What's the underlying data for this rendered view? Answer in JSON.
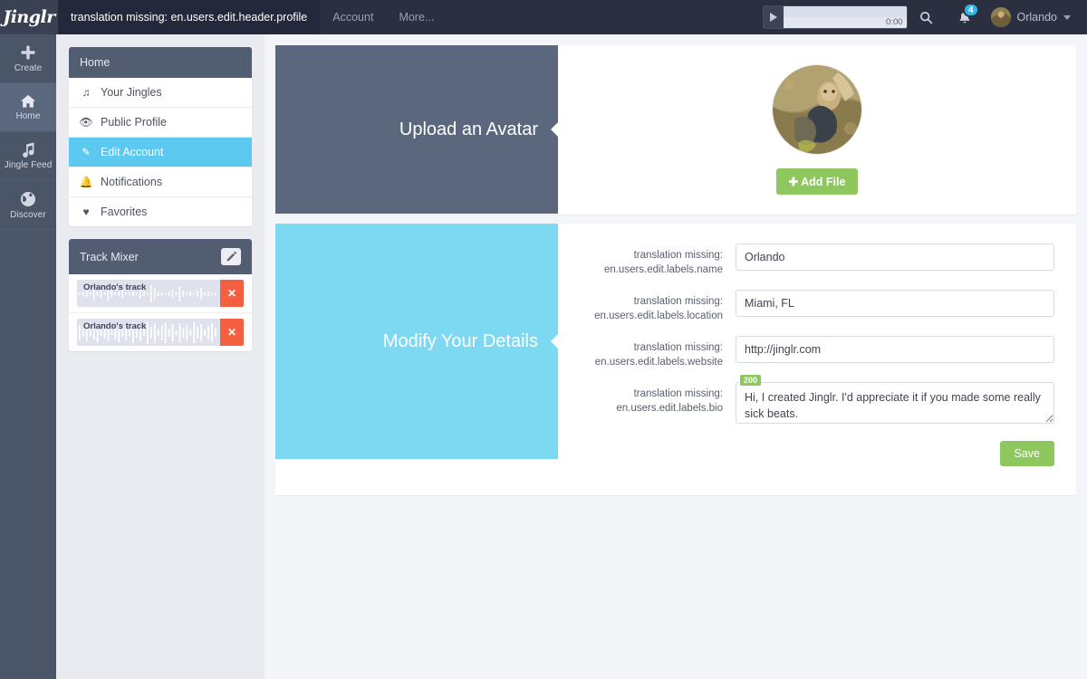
{
  "brand": {
    "name": "Jinglr"
  },
  "topbar": {
    "breadcrumb": "translation missing: en.users.edit.header.profile",
    "nav": [
      {
        "label": "Account",
        "name": "topnav-account"
      },
      {
        "label": "More...",
        "name": "topnav-more"
      }
    ],
    "player": {
      "time": "0:00",
      "play_label": "Play"
    },
    "search_icon": "search-icon",
    "notifications": {
      "icon": "bell-icon",
      "count": "4"
    },
    "user": {
      "name": "Orlando",
      "avatar": "user-avatar"
    }
  },
  "rail": {
    "items": [
      {
        "label": "Create",
        "icon": "plus-icon",
        "active": false
      },
      {
        "label": "Home",
        "icon": "house-icon",
        "active": true
      },
      {
        "label": "Jingle Feed",
        "icon": "music-note-icon",
        "active": false
      },
      {
        "label": "Discover",
        "icon": "globe-icon",
        "active": false
      }
    ]
  },
  "sidebar": {
    "home_header": "Home",
    "nav": [
      {
        "label": "Your Jingles",
        "icon": "♫",
        "active": false
      },
      {
        "label": "Public Profile",
        "icon": "👁",
        "active": false
      },
      {
        "label": "Edit Account",
        "icon": "✎",
        "active": true
      },
      {
        "label": "Notifications",
        "icon": "🔔",
        "active": false
      },
      {
        "label": "Favorites",
        "icon": "♥",
        "active": false
      }
    ],
    "mixer": {
      "title": "Track Mixer",
      "edit_icon": "pencil-icon",
      "tracks": [
        {
          "name": "Orlando's track",
          "remove_label": "✕"
        },
        {
          "name": "Orlando's track",
          "remove_label": "✕"
        }
      ]
    }
  },
  "main": {
    "avatar_card": {
      "panel_title": "Upload an Avatar",
      "add_file_label": "Add File",
      "add_file_icon": "plus-icon"
    },
    "details_card": {
      "panel_title": "Modify Your Details",
      "fields": [
        {
          "label": "translation missing:\nen.users.edit.labels.name",
          "label_line1": "translation missing:",
          "label_line2": "en.users.edit.labels.name",
          "value": "Orlando",
          "name": "name-field"
        },
        {
          "label_line1": "translation missing:",
          "label_line2": "en.users.edit.labels.location",
          "value": "Miami, FL",
          "name": "location-field"
        },
        {
          "label_line1": "translation missing:",
          "label_line2": "en.users.edit.labels.website",
          "value": "http://jinglr.com",
          "name": "website-field"
        }
      ],
      "bio": {
        "label_line1": "translation missing:",
        "label_line2": "en.users.edit.labels.bio",
        "value": "Hi, I created Jinglr. I'd appreciate it if you made some really sick beats.",
        "counter": "200"
      },
      "save_label": "Save"
    }
  },
  "colors": {
    "topbar": "#2b3040",
    "rail": "#4b5568",
    "slate_panel": "#5b677d",
    "cyan_panel": "#7dd8f2",
    "accent_cyan": "#5bc9f0",
    "green": "#8dc75e",
    "red": "#f4603f",
    "background": "#f4f5f9"
  }
}
